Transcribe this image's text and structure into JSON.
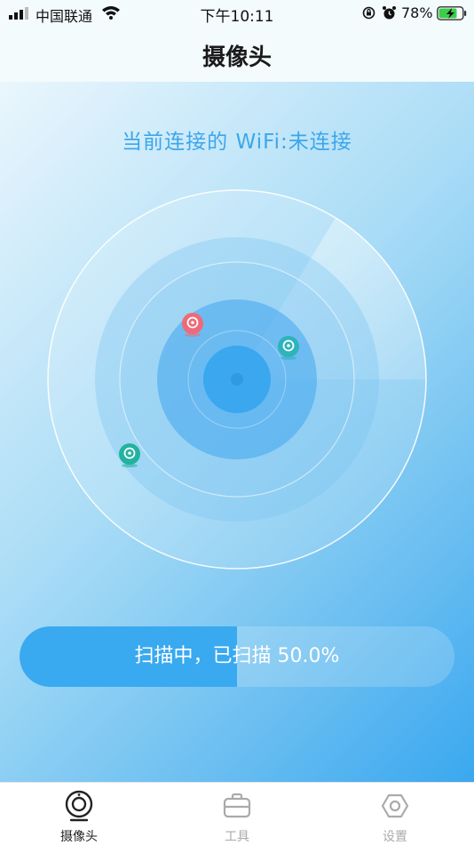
{
  "status_bar": {
    "carrier": "中国联通",
    "time": "下午10:11",
    "battery_percent": "78%",
    "battery_level": 0.78,
    "battery_charging": true,
    "icons": [
      "signal-icon",
      "wifi-icon",
      "orientation-lock-icon",
      "alarm-icon",
      "battery-charging-icon"
    ]
  },
  "header": {
    "title": "摄像头"
  },
  "main": {
    "wifi_status": "当前连接的 WiFi:未连接",
    "devices": [
      {
        "name": "camera-device-red",
        "color": "#ef6a78"
      },
      {
        "name": "camera-device-teal-1",
        "color": "#2fb3bb"
      },
      {
        "name": "camera-device-teal-2",
        "color": "#22b3a0"
      }
    ],
    "scan": {
      "text": "扫描中，已扫描 50.0%",
      "progress": 0.5
    }
  },
  "tab_bar": {
    "tabs": [
      {
        "label": "摄像头",
        "icon": "camera-icon",
        "active": true
      },
      {
        "label": "工具",
        "icon": "toolbox-icon",
        "active": false
      },
      {
        "label": "设置",
        "icon": "settings-icon",
        "active": false
      }
    ]
  },
  "colors": {
    "accent": "#39a9f0",
    "wifi_text": "#3ca6ea",
    "active_tab": "#222222",
    "inactive_tab": "#aaaaaa"
  }
}
